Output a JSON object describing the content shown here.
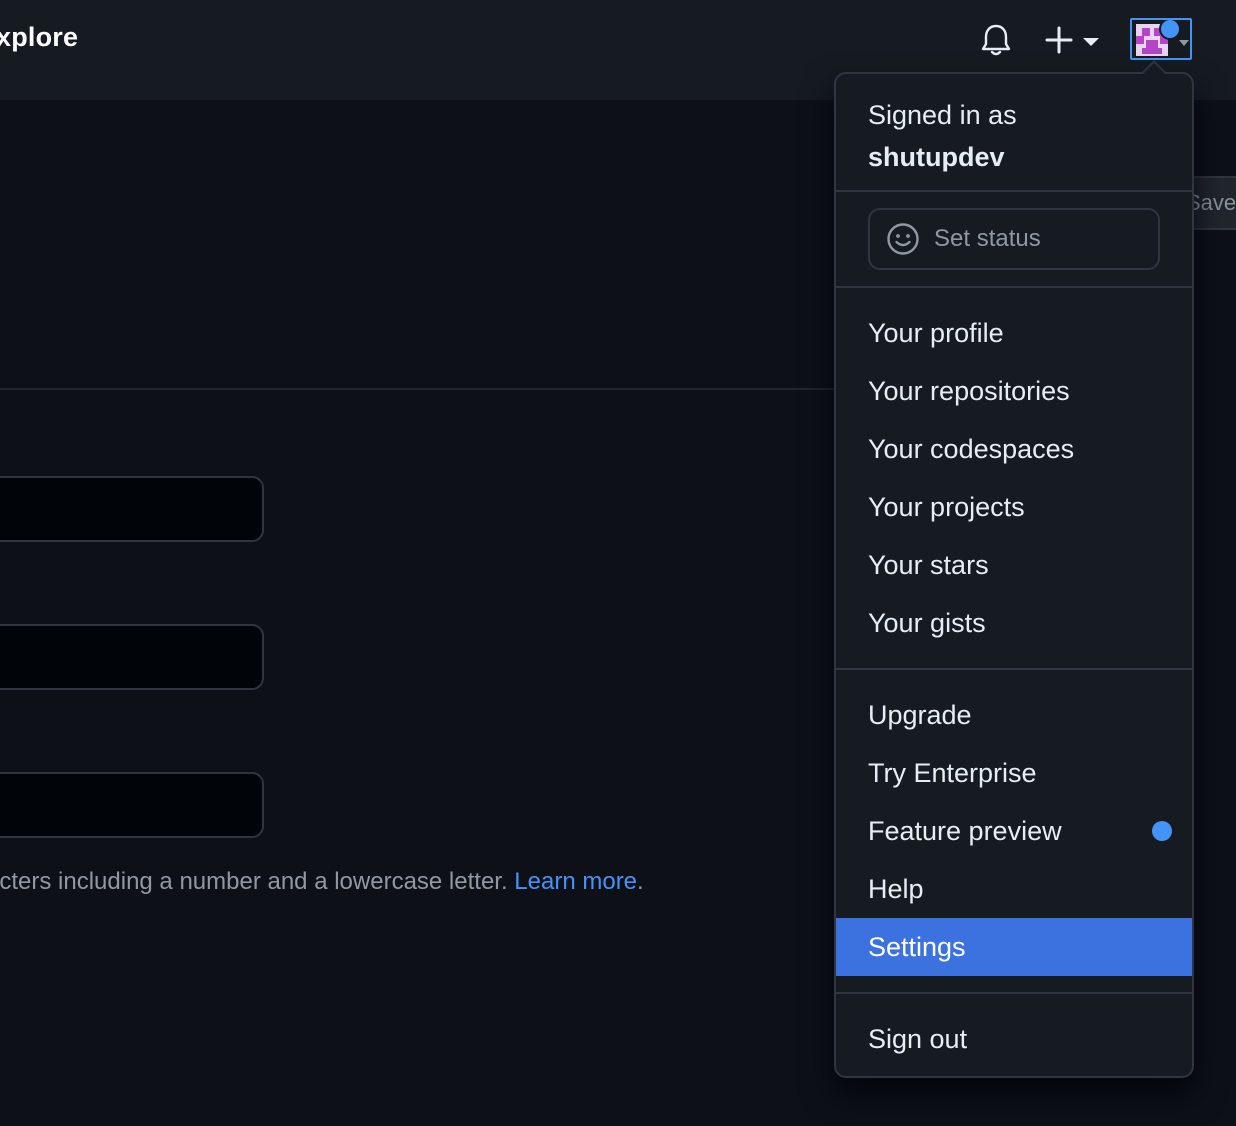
{
  "header": {
    "title": "xplore"
  },
  "background": {
    "help_text": "acters including a number and a lowercase letter.",
    "learn_more": "Learn more",
    "period": ".",
    "partial_button": "Save"
  },
  "user_menu": {
    "signed_in_prefix": "Signed in as",
    "username": "shutupdev",
    "set_status": "Set status",
    "group1": [
      "Your profile",
      "Your repositories",
      "Your codespaces",
      "Your projects",
      "Your stars",
      "Your gists"
    ],
    "group2": [
      "Upgrade",
      "Try Enterprise",
      "Feature preview",
      "Help",
      "Settings"
    ],
    "sign_out": "Sign out",
    "active_item": "Settings"
  },
  "colors": {
    "accent": "#4493f8",
    "active_bg": "#3c72e0",
    "header_bg": "#161b22",
    "page_bg": "#0d1117"
  },
  "icons": {
    "notifications": "bell-icon",
    "create": "plus-icon",
    "avatar_caret": "caret-down-icon",
    "status": "smiley-icon"
  }
}
